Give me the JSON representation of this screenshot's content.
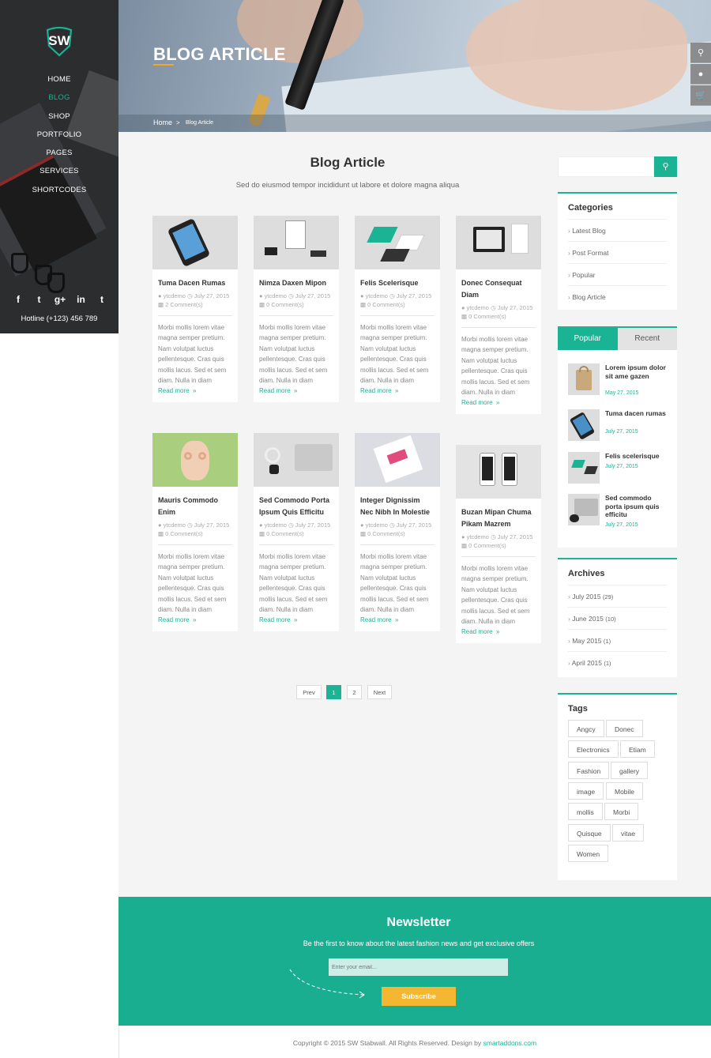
{
  "nav": {
    "brand": "SW",
    "items": [
      {
        "label": "HOME"
      },
      {
        "label": "BLOG"
      },
      {
        "label": "SHOP"
      },
      {
        "label": "PORTFOLIO"
      },
      {
        "label": "PAGES"
      },
      {
        "label": "SERVICES"
      },
      {
        "label": "SHORTCODES"
      }
    ],
    "active_index": 1,
    "social": [
      "f",
      "t",
      "g+",
      "in",
      "t"
    ],
    "hotline": "Hotline (+123) 456 789"
  },
  "hero": {
    "title": "BLOG ARTICLE",
    "breadcrumb_home": "Home",
    "breadcrumb_sep": ">",
    "breadcrumb_current": "Blog Article"
  },
  "tools": [
    "search-icon",
    "user-icon",
    "cart-icon"
  ],
  "main": {
    "title": "Blog Article",
    "subtitle": "Sed do eiusmod tempor incididunt ut labore et dolore magna aliqua"
  },
  "posts": [
    {
      "title": "Tuma Dacen Rumas",
      "author": "ytcdemo",
      "date": "July 27, 2015",
      "comments": "2 Comment(s)"
    },
    {
      "title": "Nimza Daxen Mipon",
      "author": "ytcdemo",
      "date": "July 27, 2015",
      "comments": "0 Comment(s)"
    },
    {
      "title": "Felis Scelerisque",
      "author": "ytcdemo",
      "date": "July 27, 2015",
      "comments": "0 Comment(s)"
    },
    {
      "title": "Donec Consequat Diam",
      "author": "ytcdemo",
      "date": "July 27, 2015",
      "comments": "0 Comment(s)"
    },
    {
      "title": "Mauris Commodo Enim",
      "author": "ytcdemo",
      "date": "July 27, 2015",
      "comments": "0 Comment(s)"
    },
    {
      "title": "Sed Commodo Porta Ipsum Quis Efficitu",
      "author": "ytcdemo",
      "date": "July 27, 2015",
      "comments": "0 Comment(s)"
    },
    {
      "title": "Integer Dignissim Nec Nibh In Molestie",
      "author": "ytcdemo",
      "date": "July 27, 2015",
      "comments": "0 Comment(s)"
    },
    {
      "title": "Buzan Mipan Chuma Pikam Mazrem",
      "author": "ytcdemo",
      "date": "July 27, 2015",
      "comments": "0 Comment(s)"
    }
  ],
  "excerpt": "Morbi mollis lorem vitae magna semper pretium. Nam volutpat luctus pellentesque. Cras quis mollis lacus. Sed et sem diam. Nulla in diam",
  "read_more": "Read more",
  "read_more_arrow": "»",
  "pagination": {
    "prev": "Prev",
    "pages": [
      "1",
      "2"
    ],
    "next": "Next",
    "current": "1"
  },
  "sidebar": {
    "categories_title": "Categories",
    "categories": [
      "Latest Blog",
      "Post Format",
      "Popular",
      "Blog Article"
    ],
    "tab_popular": "Popular",
    "tab_recent": "Recent",
    "popular_posts": [
      {
        "title": "Lorem ipsum dolor sit ame gazen",
        "date": "May 27, 2015"
      },
      {
        "title": "Tuma dacen rumas",
        "date": "July 27, 2015"
      },
      {
        "title": "Felis scelerisque",
        "date": "July 27, 2015"
      },
      {
        "title": "Sed commodo porta ipsum quis efficitu",
        "date": "July 27, 2015"
      }
    ],
    "archives_title": "Archives",
    "archives": [
      {
        "label": "July 2015",
        "count": "(29)"
      },
      {
        "label": "June 2015",
        "count": "(10)"
      },
      {
        "label": "May 2015",
        "count": "(1)"
      },
      {
        "label": "April 2015",
        "count": "(1)"
      }
    ],
    "tags_title": "Tags",
    "tags": [
      "Angcy",
      "Donec",
      "Electronics",
      "Etiam",
      "Fashion",
      "gallery",
      "image",
      "Mobile",
      "mollis",
      "Morbi",
      "Quisque",
      "vitae",
      "Women"
    ]
  },
  "newsletter": {
    "title": "Newsletter",
    "subtitle": "Be the first to know about the latest fashion news and get exclusive offers",
    "placeholder": "Enter your email...",
    "button": "Subscribe"
  },
  "footer": {
    "copyright": "Copyright © 2015 SW Stabwall. All Rights Reserved. Design by ",
    "link": "smartaddons.com"
  },
  "colors": {
    "accent": "#1ab394",
    "dark": "#2b2d2f",
    "cta": "#f5b731"
  }
}
